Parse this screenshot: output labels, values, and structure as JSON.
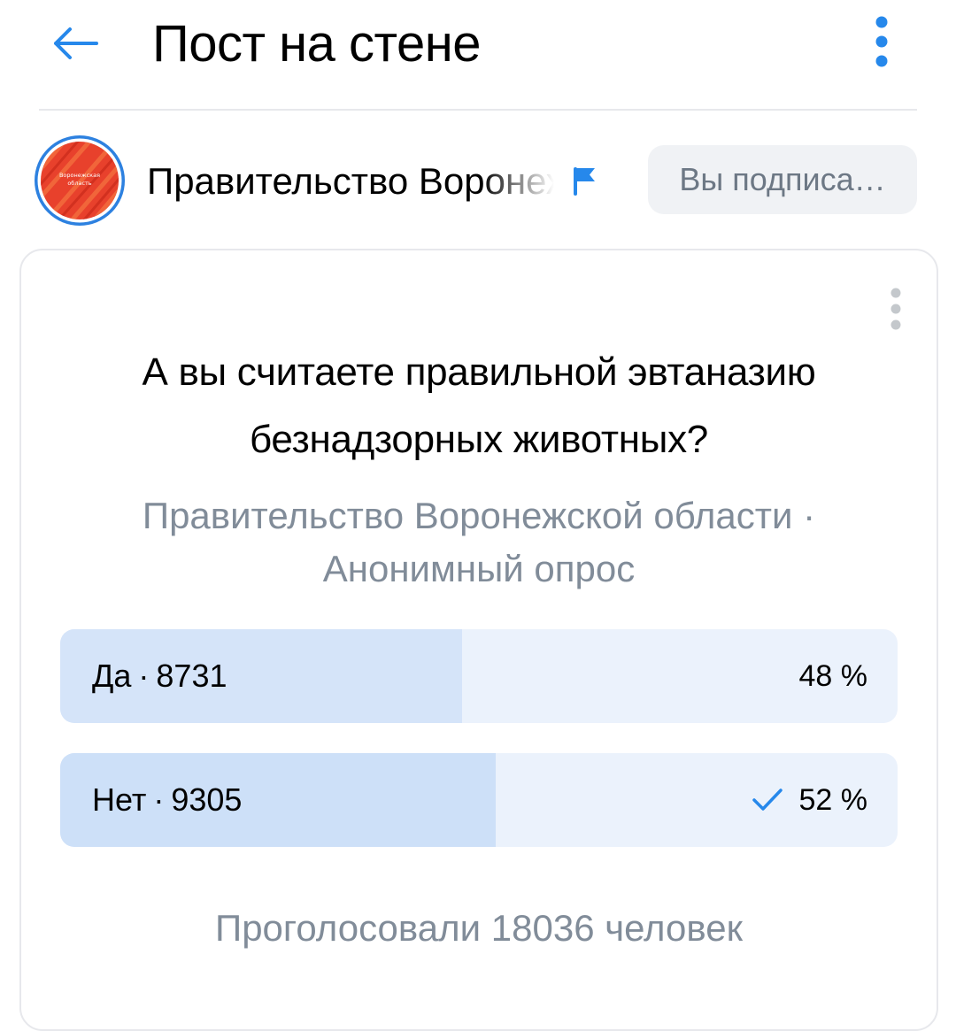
{
  "header": {
    "title": "Пост на стене",
    "back_icon": "arrow-left-icon",
    "menu_icon": "more-vertical-icon"
  },
  "author": {
    "name": "Правительство Воронежской области",
    "avatar_text_line1": "Воронежская",
    "avatar_text_line2": "область",
    "verified_icon": "flag-icon",
    "subscribe_label": "Вы подписа…"
  },
  "poll": {
    "question": "А вы считаете правильной эвтаназию безнадзорных животных?",
    "meta": "Правительство Воронежской области · Анонимный опрос",
    "options": [
      {
        "label": "Да",
        "count": "8731",
        "percent_label": "48 %",
        "percent": 48,
        "voted": false
      },
      {
        "label": "Нет",
        "count": "9305",
        "percent_label": "52 %",
        "percent": 52,
        "voted": true
      }
    ],
    "total": "Проголосовали 18036 человек"
  },
  "colors": {
    "accent": "#2688eb",
    "secondary_text": "#818c99",
    "option_bg": "#ebf2fc",
    "option_fill": "#d5e4f9",
    "avatar_red": "#e8412c",
    "avatar_ring": "#2d81e0"
  }
}
